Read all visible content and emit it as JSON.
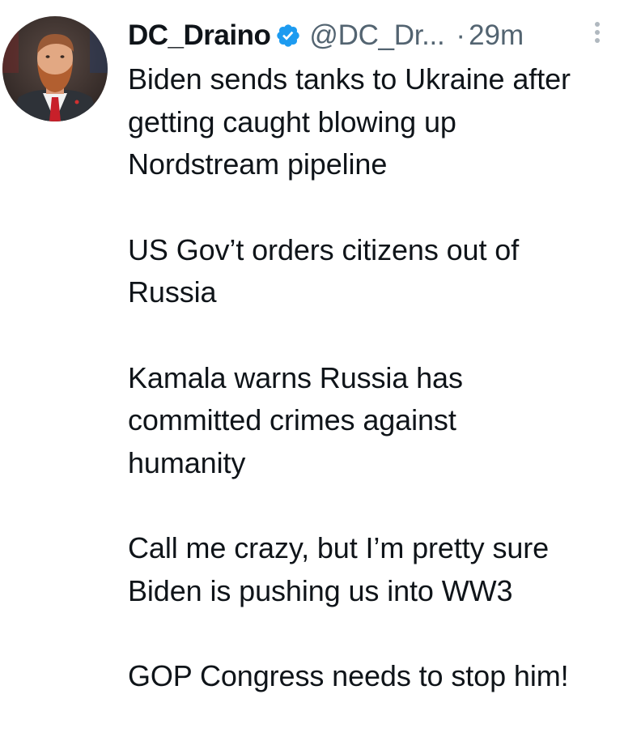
{
  "tweet": {
    "author": {
      "display_name": "DC_Draino",
      "handle": "@DC_Dr...",
      "verified": true,
      "avatar_icon": "profile-photo"
    },
    "separator": "·",
    "timestamp": "29m",
    "more_icon": "more-vertical-icon",
    "body": {
      "paragraphs": [
        [
          "Biden sends tanks to Ukraine after",
          "getting caught blowing up",
          "Nordstream pipeline"
        ],
        [
          "US Gov’t orders citizens out of",
          "Russia"
        ],
        [
          "Kamala warns Russia has",
          "committed crimes against",
          "humanity"
        ],
        [
          "Call me crazy, but I’m pretty sure",
          "Biden is pushing us into WW3"
        ],
        [
          "GOP Congress needs to stop him!"
        ]
      ]
    }
  },
  "colors": {
    "text": "#0f1419",
    "secondary": "#536471",
    "verified_badge": "#1d9bf0"
  }
}
